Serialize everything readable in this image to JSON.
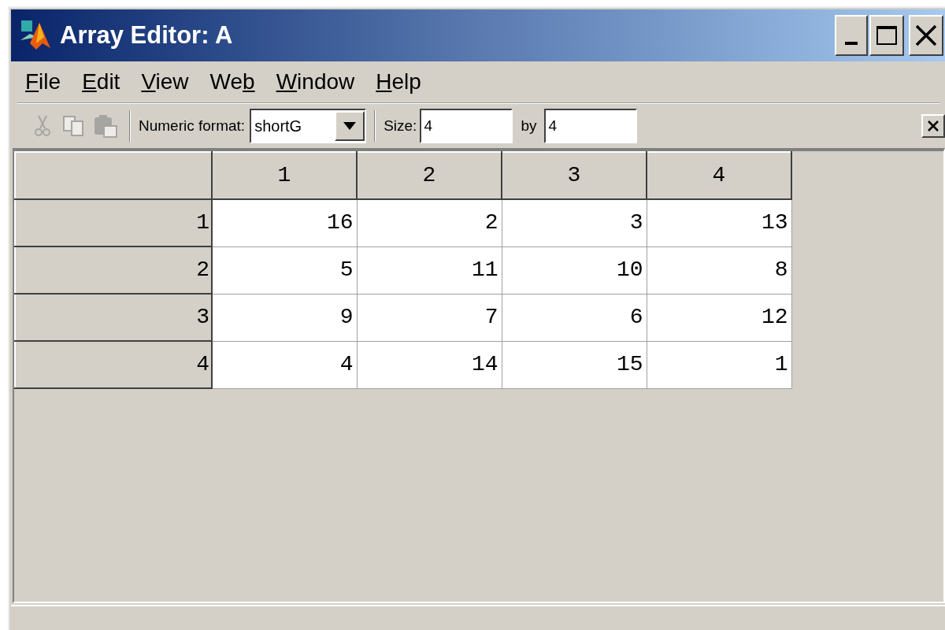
{
  "window": {
    "title": "Array Editor: A"
  },
  "menu": [
    {
      "key": "F",
      "post": "ile"
    },
    {
      "key": "E",
      "post": "dit"
    },
    {
      "key": "V",
      "post": "iew"
    },
    {
      "pre": "We",
      "key": "b"
    },
    {
      "key": "W",
      "post": "indow"
    },
    {
      "key": "H",
      "post": "elp"
    }
  ],
  "toolbar": {
    "cut_disabled": true,
    "copy_disabled": true,
    "paste_disabled": true,
    "format_label": "Numeric format:",
    "format_value": "shortG",
    "size_label": "Size:",
    "rows_value": "4",
    "by_label": "by",
    "cols_value": "4"
  },
  "table": {
    "columns": [
      "1",
      "2",
      "3",
      "4"
    ],
    "rows": [
      {
        "header": "1",
        "cells": [
          "16",
          "2",
          "3",
          "13"
        ]
      },
      {
        "header": "2",
        "cells": [
          "5",
          "11",
          "10",
          "8"
        ]
      },
      {
        "header": "3",
        "cells": [
          "9",
          "7",
          "6",
          "12"
        ]
      },
      {
        "header": "4",
        "cells": [
          "4",
          "14",
          "15",
          "1"
        ]
      }
    ]
  }
}
